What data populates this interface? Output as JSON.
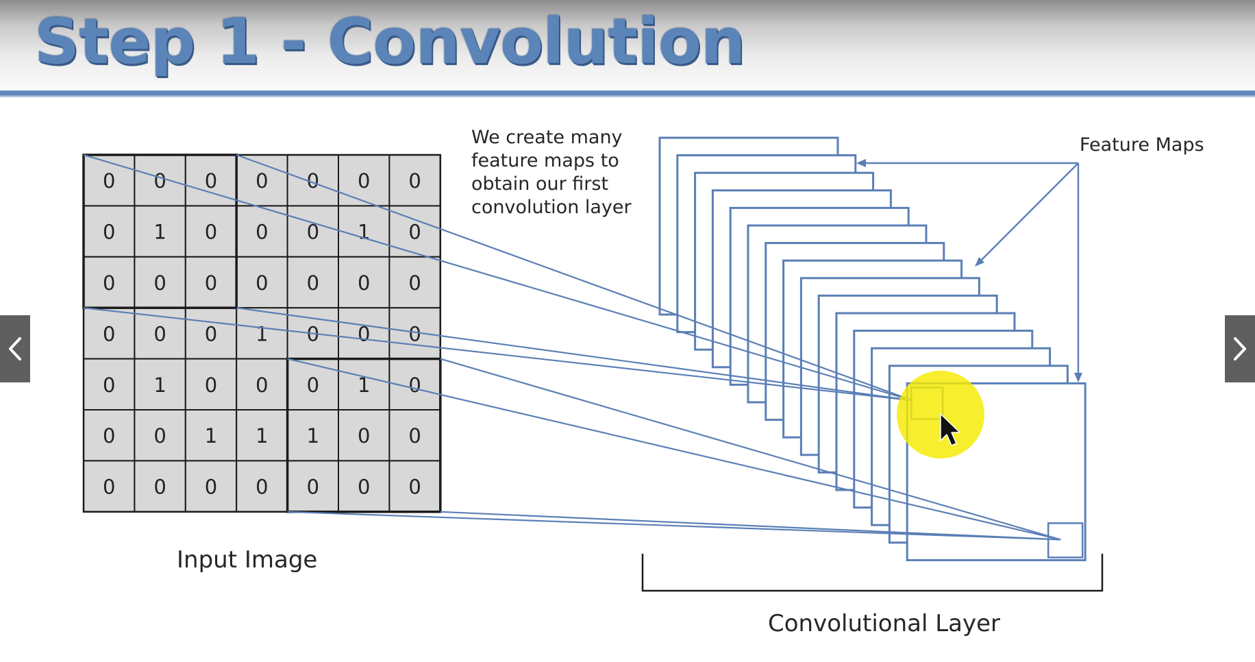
{
  "slide": {
    "title": "Step 1 - Convolution",
    "note": "We create many\nfeature maps to\nobtain our first\nconvolution layer",
    "input_label": "Input Image",
    "conv_label": "Convolutional Layer",
    "feature_label": "Feature Maps"
  },
  "input_image": [
    [
      0,
      0,
      0,
      0,
      0,
      0,
      0
    ],
    [
      0,
      1,
      0,
      0,
      0,
      1,
      0
    ],
    [
      0,
      0,
      0,
      0,
      0,
      0,
      0
    ],
    [
      0,
      0,
      0,
      1,
      0,
      0,
      0
    ],
    [
      0,
      1,
      0,
      0,
      0,
      1,
      0
    ],
    [
      0,
      0,
      1,
      1,
      1,
      0,
      0
    ],
    [
      0,
      0,
      0,
      0,
      0,
      0,
      0
    ]
  ],
  "colors": {
    "accent": "#5a7fb6",
    "cell": "#d8d8d8",
    "highlight": "#f5ea00",
    "nav": "#5f5f5f"
  },
  "icons": {
    "prev": "chevron-left-icon",
    "next": "chevron-right-icon",
    "cursor": "mouse-pointer-icon"
  }
}
